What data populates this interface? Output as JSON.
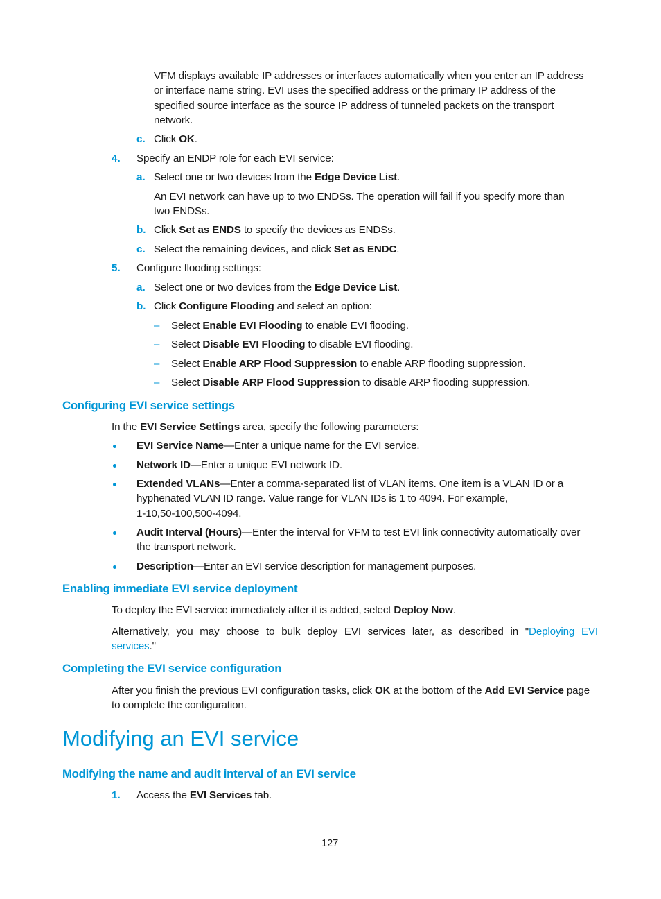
{
  "intro_paragraph": {
    "lines": [
      "VFM displays available IP addresses or interfaces automatically when you enter an IP address",
      "or interface name string. EVI uses the specified address or the primary IP address of the",
      "specified source interface as the source IP address of tunneled packets on the transport",
      "network."
    ]
  },
  "step3c": {
    "marker": "c.",
    "pre": "Click ",
    "bold": "OK",
    "post": "."
  },
  "step4": {
    "marker": "4.",
    "text": "Specify an ENDP role for each EVI service:",
    "a": {
      "marker": "a.",
      "pre": "Select one or two devices from the ",
      "bold": "Edge Device List",
      "post": "."
    },
    "note_lines": [
      "An EVI network can have up to two ENDSs. The operation will fail if you specify more than",
      "two ENDSs."
    ],
    "b": {
      "marker": "b.",
      "pre": "Click ",
      "bold": "Set as ENDS",
      "post": " to specify the devices as ENDSs."
    },
    "c": {
      "marker": "c.",
      "pre": "Select the remaining devices, and click ",
      "bold": "Set as ENDC",
      "post": "."
    }
  },
  "step5": {
    "marker": "5.",
    "text": "Configure flooding settings:",
    "a": {
      "marker": "a.",
      "pre": "Select one or two devices from the ",
      "bold": "Edge Device List",
      "post": "."
    },
    "b": {
      "marker": "b.",
      "pre": "Click ",
      "bold": "Configure Flooding",
      "post": " and select an option:"
    },
    "options": [
      {
        "pre": "Select ",
        "bold": "Enable EVI Flooding",
        "post": " to enable EVI flooding."
      },
      {
        "pre": "Select ",
        "bold": "Disable EVI Flooding",
        "post": " to disable EVI flooding."
      },
      {
        "pre": "Select ",
        "bold": "Enable ARP Flood Suppression",
        "post": " to enable ARP flooding suppression."
      },
      {
        "pre": "Select ",
        "bold": "Disable ARP Flood Suppression",
        "post": " to disable ARP flooding suppression."
      }
    ]
  },
  "section_settings": {
    "heading": "Configuring EVI service settings",
    "intro": {
      "pre": "In the ",
      "bold": "EVI Service Settings",
      "post": " area, specify the following parameters:"
    },
    "bullets": [
      {
        "bold": "EVI Service Name",
        "lines": [
          "—Enter a unique name for the EVI service."
        ]
      },
      {
        "bold": "Network ID",
        "lines": [
          "—Enter a unique EVI network ID."
        ]
      },
      {
        "bold": "Extended VLANs",
        "lines": [
          "—Enter a comma-separated list of VLAN items. One item is a VLAN ID or a",
          "hyphenated VLAN ID range. Value range for VLAN IDs is 1 to 4094. For example,",
          "1-10,50-100,500-4094."
        ]
      },
      {
        "bold": "Audit Interval (Hours)",
        "lines": [
          "—Enter the interval for VFM to test EVI link connectivity automatically over",
          "the transport network."
        ]
      },
      {
        "bold": "Description",
        "lines": [
          "—Enter an EVI service description for management purposes."
        ]
      }
    ]
  },
  "section_deploy": {
    "heading": "Enabling immediate EVI service deployment",
    "p1": {
      "pre": "To deploy the EVI service immediately after it is added, select ",
      "bold": "Deploy Now",
      "post": "."
    },
    "p2": {
      "line1_pre": "Alternatively, you may choose to bulk deploy EVI services later, as described in \"",
      "link_part1": "Deploying EVI",
      "link_part2": "services",
      "line2_post": ".\""
    }
  },
  "section_complete": {
    "heading": "Completing the EVI service configuration",
    "p": {
      "pre": "After you finish the previous EVI configuration tasks, click ",
      "bold1": "OK",
      "mid": " at the bottom of the ",
      "bold2": "Add EVI Service",
      "post": " page",
      "line2": "to complete the configuration."
    }
  },
  "chapter": {
    "title": "Modifying an EVI service",
    "subheading": "Modifying the name and audit interval of an EVI service",
    "step1": {
      "marker": "1.",
      "pre": "Access the ",
      "bold": "EVI Services",
      "post": " tab."
    }
  },
  "page_number": "127"
}
